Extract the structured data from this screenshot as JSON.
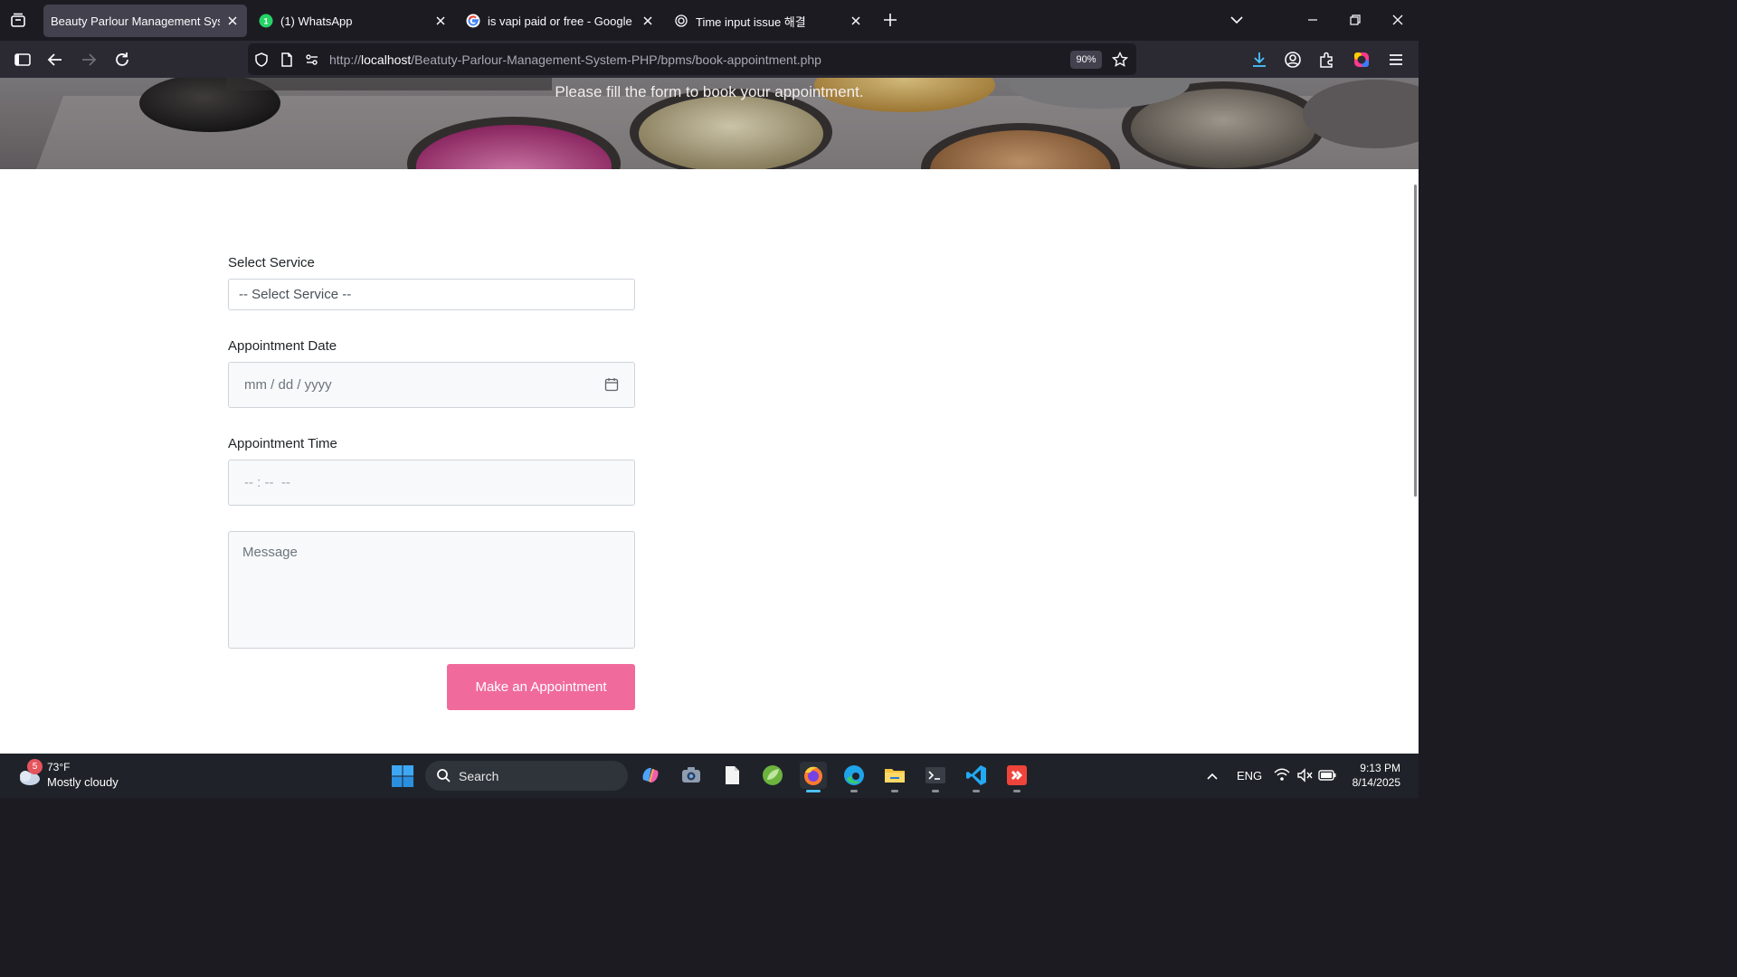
{
  "browser": {
    "tabs": [
      {
        "title": "Beauty Parlour Management System",
        "active": true,
        "icon": "page-favicon"
      },
      {
        "title": "(1) WhatsApp",
        "active": false,
        "icon": "whatsapp-icon"
      },
      {
        "title": "is vapi paid or free - Google Sea",
        "active": false,
        "icon": "google-icon"
      },
      {
        "title": "Time input issue 해결",
        "active": false,
        "icon": "chatgpt-icon"
      }
    ],
    "url_prefix": "http://",
    "url_host": "localhost",
    "url_path": "/Beatuty-Parlour-Management-System-PHP/bpms/book-appointment.php",
    "zoom": "90%"
  },
  "page": {
    "hero_caption": "Please fill the form to book your appointment.",
    "form": {
      "service_label": "Select Service",
      "service_value": "-- Select Service --",
      "date_label": "Appointment Date",
      "date_placeholder": "mm / dd / yyyy",
      "time_label": "Appointment Time",
      "time_placeholder": "-- : --  --",
      "message_placeholder": "Message",
      "submit_label": "Make an Appointment"
    },
    "accent_color": "#f06b9c"
  },
  "taskbar": {
    "weather_badge": "5",
    "weather_temp": "73°F",
    "weather_desc": "Mostly cloudy",
    "search_label": "Search",
    "apps": [
      "copilot-icon",
      "camera-icon",
      "notepad-icon",
      "spring-icon",
      "firefox-icon",
      "edge-icon",
      "file-explorer-icon",
      "terminal-icon",
      "vscode-icon",
      "anydesk-icon"
    ],
    "language": "ENG",
    "time": "9:13 PM",
    "date": "8/14/2025"
  }
}
